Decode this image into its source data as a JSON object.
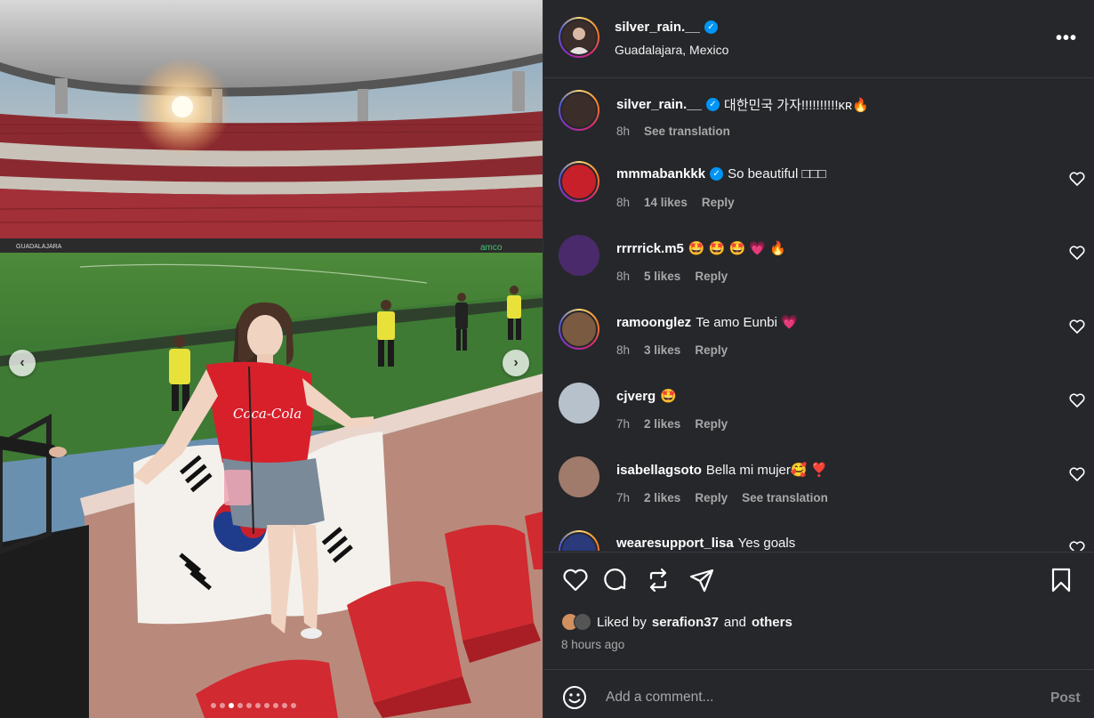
{
  "post": {
    "author": "silver_rain.__",
    "location": "Guadalajara, Mexico",
    "more_label": "•••",
    "media": {
      "prev_label": "‹",
      "next_label": "›",
      "dot_count": 10,
      "active_dot": 2,
      "jersey_text": "Coca-Cola",
      "board_text": "GUADALAJARA",
      "ad_text": "amco"
    }
  },
  "comments": [
    {
      "user": "silver_rain.__",
      "verified": true,
      "text": "대한민국 가자!!!!!!!!!!ᴋʀ🔥",
      "time": "8h",
      "likes": "",
      "reply": "",
      "translate": "See translation",
      "show_heart": false,
      "avatar_color": "#3a2d2a"
    },
    {
      "user": "mmmabankkk",
      "verified": true,
      "text": "So beautiful □□□",
      "time": "8h",
      "likes": "14 likes",
      "reply": "Reply",
      "translate": "",
      "show_heart": true,
      "avatar_color": "#c8202a"
    },
    {
      "user": "rrrrrick.m5",
      "verified": false,
      "text": "🤩 🤩 🤩 💗 🔥",
      "time": "8h",
      "likes": "5 likes",
      "reply": "Reply",
      "translate": "",
      "show_heart": true,
      "avatar_color": "#4a2a6a"
    },
    {
      "user": "ramoonglez",
      "verified": false,
      "text": "Te amo Eunbi 💗",
      "time": "8h",
      "likes": "3 likes",
      "reply": "Reply",
      "translate": "",
      "show_heart": true,
      "avatar_color": "#7a5a40"
    },
    {
      "user": "cjverg",
      "verified": false,
      "text": "🤩",
      "time": "7h",
      "likes": "2 likes",
      "reply": "Reply",
      "translate": "",
      "show_heart": true,
      "avatar_color": "#b7c1cc"
    },
    {
      "user": "isabellagsoto",
      "verified": false,
      "text": "Bella mi mujer🥰 ❣️",
      "time": "7h",
      "likes": "2 likes",
      "reply": "Reply",
      "translate": "See translation",
      "show_heart": true,
      "avatar_color": "#a07a6a"
    },
    {
      "user": "wearesupport_lisa",
      "verified": false,
      "text": "Yes goals",
      "time": "",
      "likes": "",
      "reply": "",
      "translate": "",
      "show_heart": true,
      "avatar_color": "#2a3a7a"
    }
  ],
  "actions": {
    "liked_prefix": "Liked by",
    "liked_user": "serafion37",
    "liked_and": "and",
    "liked_others": "others",
    "time_ago": "8 hours ago"
  },
  "composer": {
    "placeholder": "Add a comment...",
    "post_label": "Post"
  },
  "colors": {
    "sidebar_bg": "#26272b",
    "accent": "#0095f6",
    "divider": "#3a3b40",
    "heart_pink": "#ff3c7a"
  }
}
